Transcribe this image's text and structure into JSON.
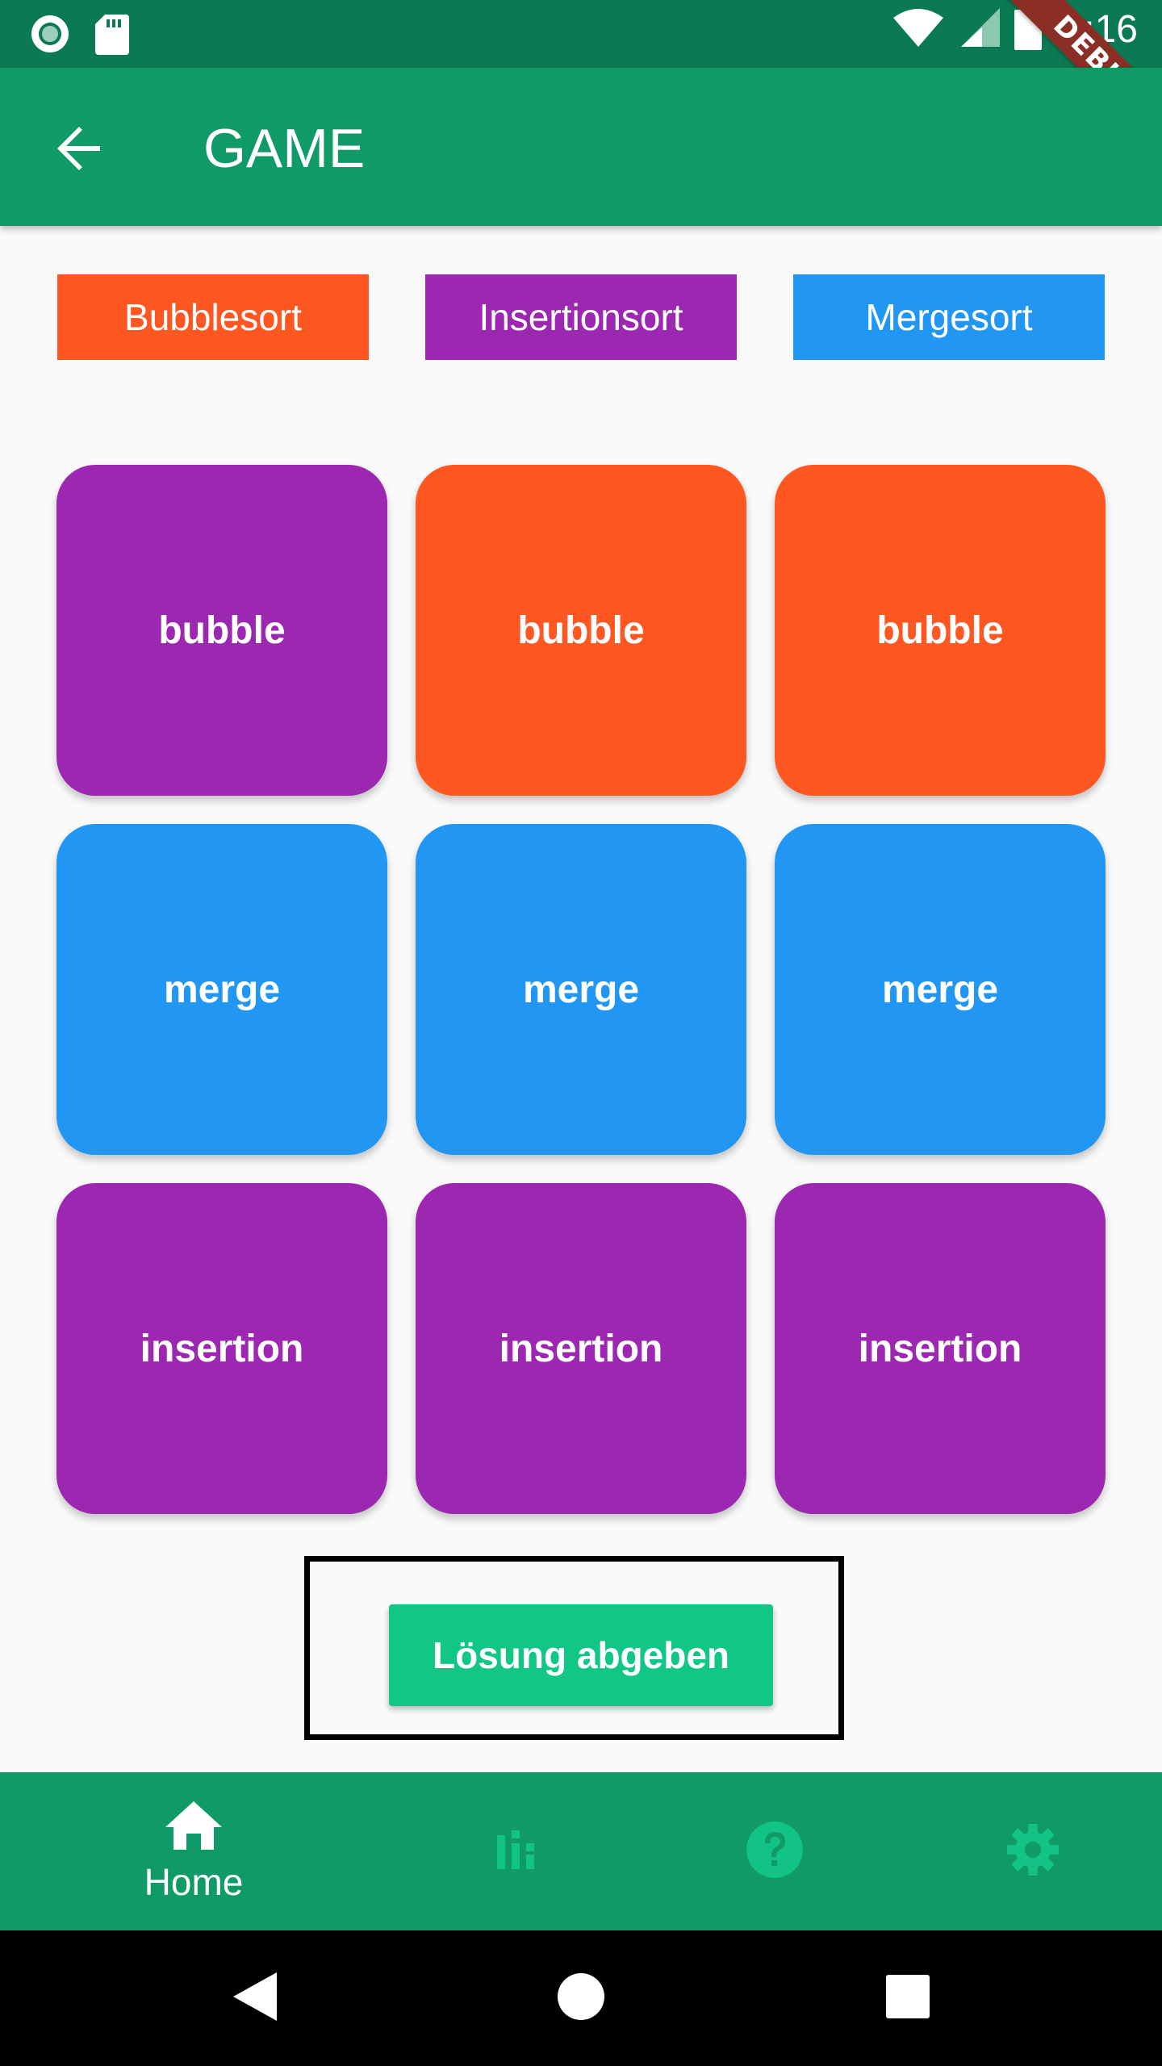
{
  "status_bar": {
    "time": "4:16",
    "icons": [
      "circle-notification-icon",
      "sd-card-icon",
      "wifi-icon",
      "signal-icon",
      "battery-icon"
    ]
  },
  "debug_banner": "DEBUG",
  "app_bar": {
    "title": "GAME",
    "back_icon": "arrow-back-icon"
  },
  "legend": [
    {
      "label": "Bubblesort",
      "color": "#ff5722"
    },
    {
      "label": "Insertionsort",
      "color": "#9c27b0"
    },
    {
      "label": "Mergesort",
      "color": "#2196f3"
    }
  ],
  "tiles": [
    {
      "label": "bubble",
      "color": "#9c27b0"
    },
    {
      "label": "bubble",
      "color": "#ff5722"
    },
    {
      "label": "bubble",
      "color": "#ff5722"
    },
    {
      "label": "merge",
      "color": "#2196f3"
    },
    {
      "label": "merge",
      "color": "#2196f3"
    },
    {
      "label": "merge",
      "color": "#2196f3"
    },
    {
      "label": "insertion",
      "color": "#9c27b0"
    },
    {
      "label": "insertion",
      "color": "#9c27b0"
    },
    {
      "label": "insertion",
      "color": "#9c27b0"
    }
  ],
  "submit": {
    "label": "Lösung abgeben",
    "color": "#12c785"
  },
  "bottom_nav": {
    "items": [
      {
        "label": "Home",
        "icon": "home-icon",
        "active": true
      },
      {
        "label": "",
        "icon": "bar-chart-icon",
        "active": false
      },
      {
        "label": "",
        "icon": "help-icon",
        "active": false
      },
      {
        "label": "",
        "icon": "settings-icon",
        "active": false
      }
    ],
    "active_color": "#ffffff",
    "inactive_color": "#13c285"
  },
  "system_nav": [
    "back-triangle-icon",
    "home-circle-icon",
    "recents-square-icon"
  ]
}
